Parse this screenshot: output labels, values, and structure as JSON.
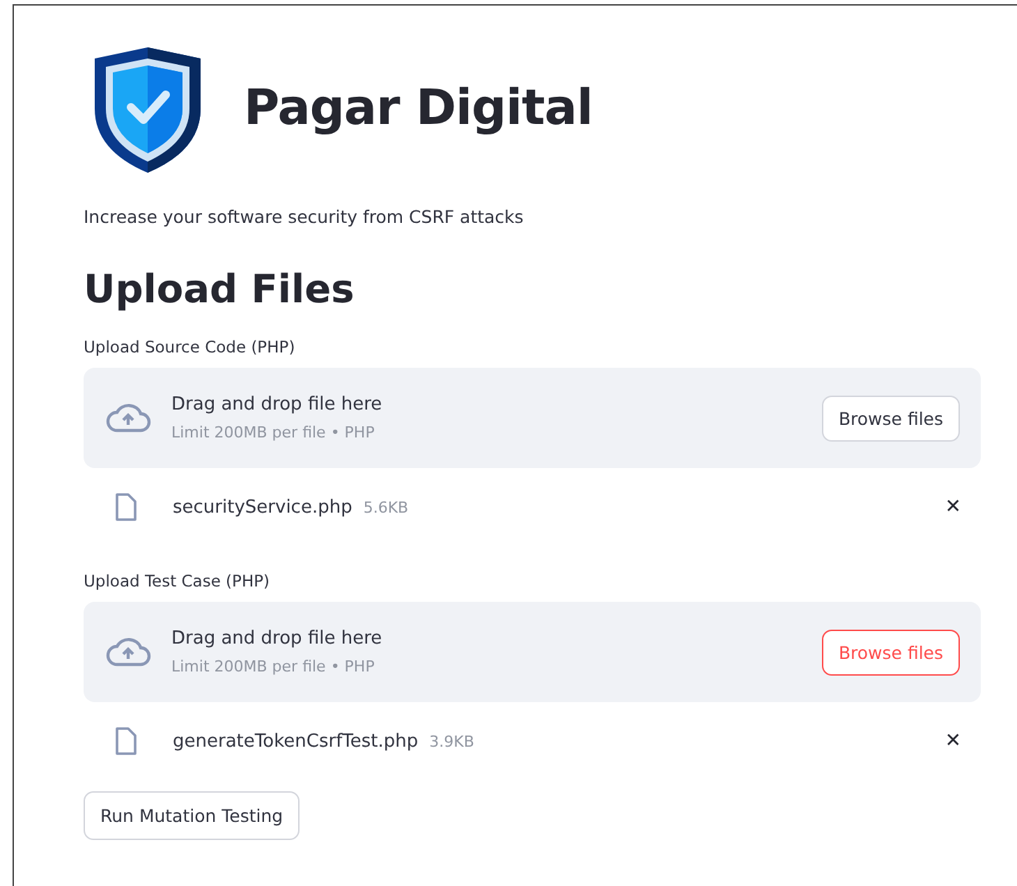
{
  "header": {
    "title": "Pagar Digital",
    "subtitle": "Increase your software security from CSRF attacks"
  },
  "section_title": "Upload Files",
  "uploaders": [
    {
      "label": "Upload Source Code (PHP)",
      "drop_text": "Drag and drop file here",
      "limit_text": "Limit 200MB per file • PHP",
      "browse_button": {
        "label": "Browse files",
        "focused": false
      },
      "file": {
        "name": "securityService.php",
        "size": "5.6KB",
        "remove": "✕"
      }
    },
    {
      "label": "Upload Test Case (PHP)",
      "drop_text": "Drag and drop file here",
      "limit_text": "Limit 200MB per file • PHP",
      "browse_button": {
        "label": "Browse files",
        "focused": true
      },
      "file": {
        "name": "generateTokenCsrfTest.php",
        "size": "3.9KB",
        "remove": "✕"
      }
    }
  ],
  "run_button": "Run Mutation Testing"
}
